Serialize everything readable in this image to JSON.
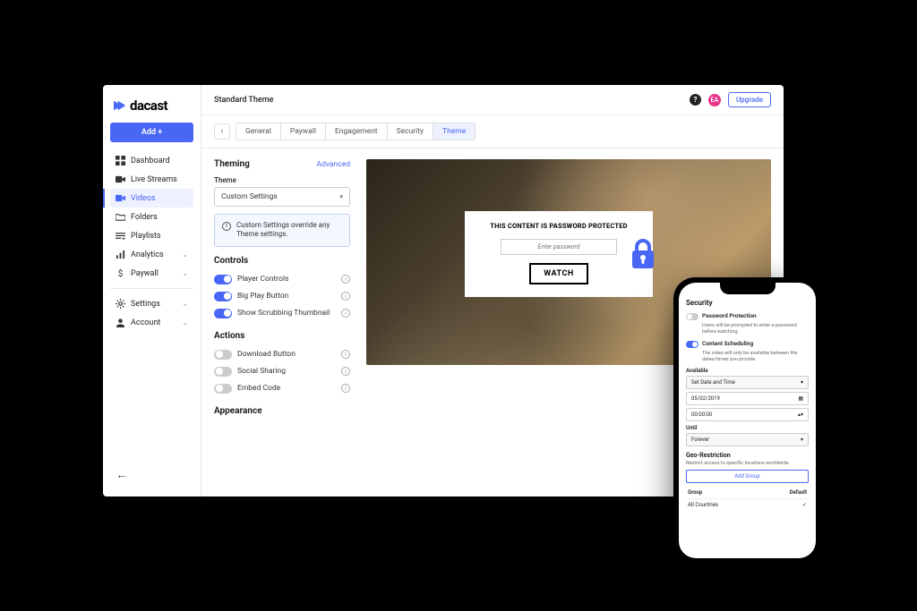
{
  "logo_text": "dacast",
  "add_button": "Add +",
  "sidebar": {
    "items": [
      {
        "label": "Dashboard"
      },
      {
        "label": "Live Streams"
      },
      {
        "label": "Videos"
      },
      {
        "label": "Folders"
      },
      {
        "label": "Playlists"
      },
      {
        "label": "Analytics"
      },
      {
        "label": "Paywall"
      }
    ],
    "bottom": [
      {
        "label": "Settings"
      },
      {
        "label": "Account"
      }
    ]
  },
  "header": {
    "title": "Standard Theme",
    "avatar_initials": "EA",
    "upgrade": "Upgrade"
  },
  "tabs": [
    "General",
    "Paywall",
    "Engagement",
    "Security",
    "Theme"
  ],
  "theming": {
    "title": "Theming",
    "advanced": "Advanced",
    "theme_label": "Theme",
    "theme_value": "Custom Settings",
    "info": "Custom Settings override any Theme settings."
  },
  "controls": {
    "title": "Controls",
    "items": [
      "Player Controls",
      "Big Play Button",
      "Show Scrubbing Thumbnail"
    ]
  },
  "actions": {
    "title": "Actions",
    "items": [
      "Download Button",
      "Social Sharing",
      "Embed Code"
    ]
  },
  "appearance": {
    "title": "Appearance"
  },
  "preview": {
    "overlay_title": "THIS CONTENT IS PASSWORD PROTECTED",
    "placeholder": "Enter password",
    "watch": "WATCH"
  },
  "phone": {
    "security": "Security",
    "pw_label": "Password Protection",
    "pw_desc": "Users will be prompted to enter a password before watching.",
    "cs_label": "Content Scheduling",
    "cs_desc": "The video will only be available between the dates/times you provide.",
    "available": "Available",
    "set_date": "Set Date and Time",
    "date_value": "05/02/2019",
    "time_value": "00:00:00",
    "until": "Until",
    "forever": "Forever",
    "geo_title": "Geo-Restriction",
    "geo_desc": "Restrict access to specific locations worldwide.",
    "add_group": "Add Group",
    "col_group": "Group",
    "col_default": "Default",
    "row_group": "All Countries"
  }
}
